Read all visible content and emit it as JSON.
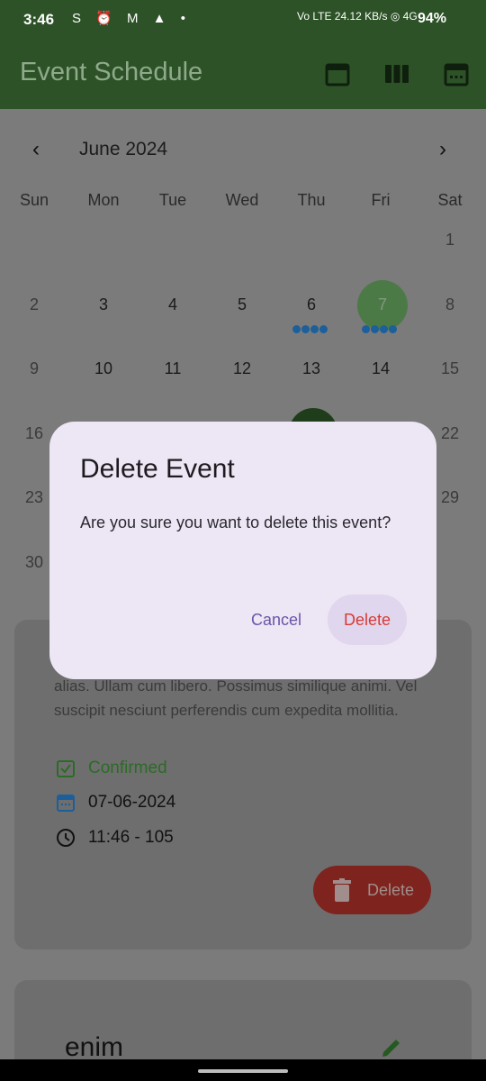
{
  "status": {
    "time": "3:46",
    "left_icons": "S ⏰ M ▲ •",
    "network": "Vo LTE 24.12 KB/s ◎ 4G",
    "battery": "94%"
  },
  "appbar": {
    "title": "Event Schedule",
    "icons": [
      "calendar-month-icon",
      "view-week-icon",
      "calendar-day-icon"
    ]
  },
  "calendar": {
    "month": "June 2024",
    "prev": "‹",
    "next": "›",
    "weekdays": [
      "Sun",
      "Mon",
      "Tue",
      "Wed",
      "Thu",
      "Fri",
      "Sat"
    ],
    "rows": [
      [
        "",
        "",
        "",
        "",
        "",
        "",
        "1"
      ],
      [
        "2",
        "3",
        "4",
        "5",
        "6",
        "7",
        "8"
      ],
      [
        "9",
        "10",
        "11",
        "12",
        "13",
        "14",
        "15"
      ],
      [
        "16",
        "",
        "",
        "",
        "",
        "",
        "22"
      ],
      [
        "23",
        "",
        "",
        "",
        "",
        "",
        "29"
      ],
      [
        "30",
        "",
        "",
        "",
        "",
        "",
        ""
      ]
    ]
  },
  "event_card": {
    "description": "alias. Ullam cum libero. Possimus similique animi. Vel suscipit nesciunt perferendis cum expedita mollitia.",
    "status": "Confirmed",
    "date": "07-06-2024",
    "time": "11:46 - 105",
    "delete_label": "Delete"
  },
  "next_card": {
    "title": "enim"
  },
  "dialog": {
    "title": "Delete Event",
    "message": "Are you sure you want to delete this event?",
    "cancel": "Cancel",
    "delete": "Delete"
  },
  "colors": {
    "appbar": "#2d5227",
    "dot": "#1c5f9a",
    "dialog_bg": "#ede6f4",
    "delete_text": "#d93a37",
    "cancel_text": "#6a55a8"
  }
}
